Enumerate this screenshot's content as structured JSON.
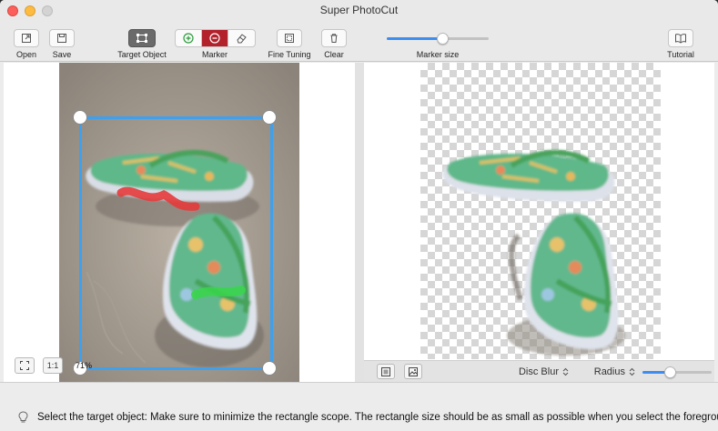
{
  "window": {
    "title": "Super PhotoCut"
  },
  "toolbar": {
    "open_label": "Open",
    "save_label": "Save",
    "target_object_label": "Target Object",
    "marker_label": "Marker",
    "fine_tuning_label": "Fine Tuning",
    "clear_label": "Clear",
    "marker_size_label": "Marker size",
    "marker_size_level": 0.55,
    "tutorial_label": "Tutorial",
    "active_marker": "remove-marker"
  },
  "left_pane": {
    "zoom_fit_icon": "fit-screen-icon",
    "zoom_actual_label": "1:1",
    "zoom_percent": "71%"
  },
  "right_pane": {
    "blur_mode": "Disc Blur",
    "radius_label": "Radius",
    "radius_level": 0.4
  },
  "status": {
    "hint": "Select the target object: Make sure to minimize the rectangle scope. The rectangle size should be as small as possible when you select the foreground,It should"
  },
  "colors": {
    "accent": "#3b8ef0",
    "selection": "#3fa0ee",
    "marker_remove": "#b3212a",
    "marker_add_stroke": "#2b9b3b",
    "marker_red_stroke": "#e53b3b",
    "marker_green_stroke": "#38d64a"
  }
}
